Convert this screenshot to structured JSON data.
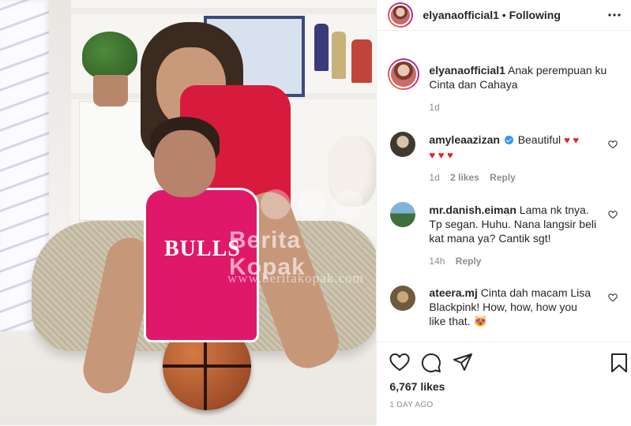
{
  "photo": {
    "jersey_text": "BULLS",
    "watermark": "Berita Kopak",
    "watermark_url": "www.beritakopak.com"
  },
  "header": {
    "username": "elyanaofficial1",
    "separator": "•",
    "follow_status": "Following",
    "more_icon": "more-horizontal-icon"
  },
  "caption": {
    "username": "elyanaofficial1",
    "text_line1": "Anak perempuan ku",
    "text_line2": "Cinta dan Cahaya",
    "time": "1d"
  },
  "comments": [
    {
      "username": "amyleaazizan",
      "verified": true,
      "text": "Beautiful",
      "hearts_line1": "♥ ♥",
      "hearts_line2": "♥ ♥ ♥",
      "time": "1d",
      "likes": "2 likes",
      "reply": "Reply"
    },
    {
      "username": "mr.danish.eiman",
      "text_line1": "Lama nk tnya.",
      "text_line2": "Tp segan. Huhu. Nana langsir beli",
      "text_line3": "kat mana ya? Cantik sgt!",
      "time": "14h",
      "reply": "Reply"
    },
    {
      "username": "ateera.mj",
      "text_line1": "Cinta dah macam Lisa",
      "text_line2": "Blackpink! How, how, how you",
      "text_line3": "like that.",
      "emoji": "😻"
    }
  ],
  "actions": {
    "likes": "6,767 likes",
    "posted": "1 DAY AGO",
    "icons": [
      "heart-icon",
      "comment-icon",
      "share-icon",
      "bookmark-icon"
    ]
  },
  "colors": {
    "accent_blue": "#3897f0",
    "heart_red": "#e0262f",
    "muted": "#8e8e8e"
  }
}
